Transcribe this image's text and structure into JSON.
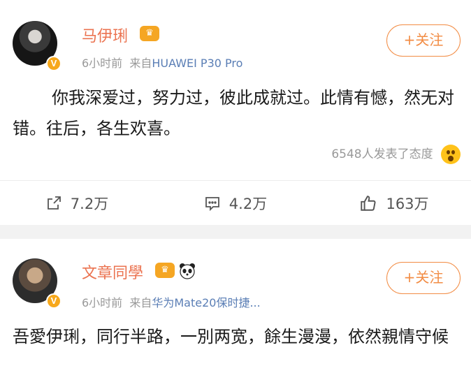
{
  "posts": [
    {
      "username": "马伊琍",
      "time": "6小时前",
      "source_prefix": "来自",
      "source": "HUAWEI P30 Pro",
      "follow_label": "+关注",
      "content": "你我深爱过，努力过，彼此成就过。此情有憾，然无对错。往后，各生欢喜。",
      "reactions_text": "6548人发表了态度",
      "reposts": "7.2万",
      "comments": "4.2万",
      "likes": "163万"
    },
    {
      "username": "文章同學",
      "time": "6小时前",
      "source_prefix": "来自",
      "source": "华为Mate20保时捷...",
      "follow_label": "+关注",
      "content": "吾愛伊琍，同行半路，一別两宽，餘生漫漫，依然親情守候"
    }
  ],
  "badges": {
    "verified": "V",
    "crown_icon": "crown-icon",
    "panda_icon": "panda-icon"
  },
  "colors": {
    "accent": "#eb7350",
    "follow": "#f28c44",
    "source": "#5a7eb5",
    "separator": "#f2f2f2"
  }
}
